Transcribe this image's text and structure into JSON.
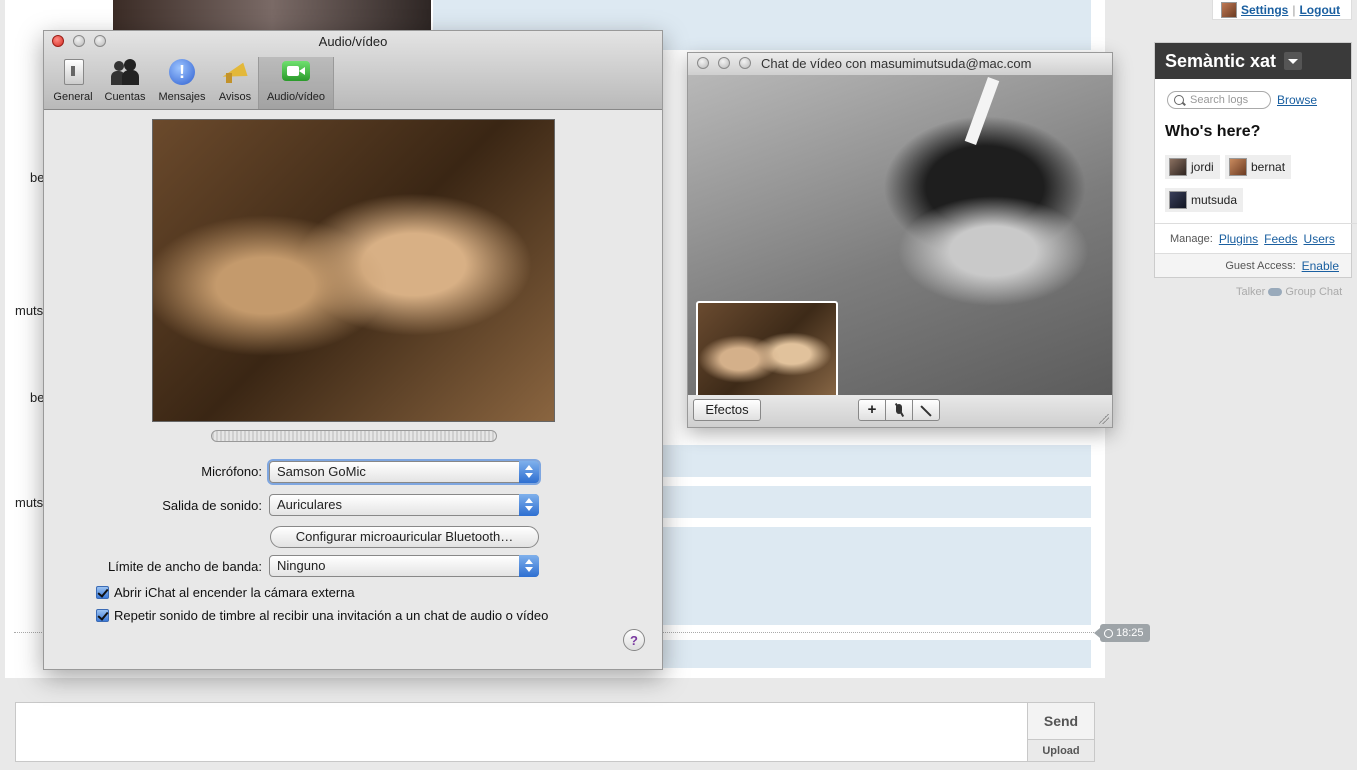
{
  "chat": {
    "senders": [
      "be",
      "muts",
      "be",
      "muts"
    ],
    "time": "18:25",
    "send_label": "Send",
    "upload_label": "Upload"
  },
  "userbar": {
    "settings": "Settings",
    "separator": "|",
    "logout": "Logout"
  },
  "room": {
    "name": "Semàntic xat",
    "search_placeholder": "Search logs",
    "browse": "Browse",
    "whos_here": "Who's here?",
    "users": [
      "jordi",
      "bernat",
      "mutsuda"
    ],
    "manage_label": "Manage:",
    "manage_links": [
      "Plugins",
      "Feeds",
      "Users"
    ],
    "guest_label": "Guest Access:",
    "guest_link": "Enable",
    "powered": [
      "Talker",
      "Group Chat"
    ]
  },
  "prefs": {
    "title": "Audio/vídeo",
    "tabs": [
      "General",
      "Cuentas",
      "Mensajes",
      "Avisos",
      "Audio/vídeo"
    ],
    "microphone_label": "Micrófono:",
    "microphone_value": "Samson GoMic",
    "output_label": "Salida de sonido:",
    "output_value": "Auriculares",
    "bluetooth_button": "Configurar microauricular Bluetooth…",
    "bandwidth_label": "Límite de ancho de banda:",
    "bandwidth_value": "Ninguno",
    "check_open": "Abrir iChat al encender la cámara externa",
    "check_ring": "Repetir sonido de timbre al recibir una invitación a un chat de audio o vídeo",
    "help": "?"
  },
  "video_chat": {
    "title": "Chat de vídeo con masumimutsuda@mac.com",
    "effects": "Efectos",
    "add_btn": "+"
  },
  "icons": [
    "close-icon",
    "minimize-icon",
    "zoom-icon",
    "switch-icon",
    "accounts-icon",
    "messages-icon",
    "alerts-icon",
    "video-camera-icon",
    "mute-microphone-icon",
    "fullscreen-icon",
    "search-icon",
    "clock-icon",
    "dropdown-icon"
  ],
  "colors": {
    "link": "#1a5fa0",
    "room_header": "#3a3a3a",
    "message_bg": "#dde9f2",
    "time_badge": "#9ea4a8"
  }
}
